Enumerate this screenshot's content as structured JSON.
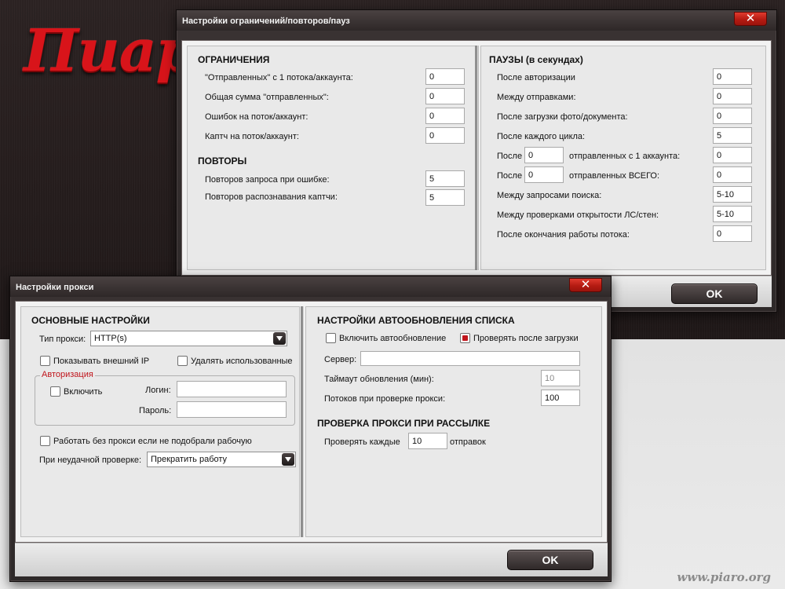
{
  "logo_text": "Пиар",
  "watermark": "www.piaro.org",
  "limits_window": {
    "title": "Настройки ограничений/повторов/пауз",
    "close_glyph": "✕",
    "ok_label": "OK",
    "limits": {
      "heading": "ОГРАНИЧЕНИЯ",
      "rows": [
        {
          "label": "\"Отправленных\" с 1 потока/аккаунта:",
          "value": "0"
        },
        {
          "label": "Общая сумма \"отправленных\":",
          "value": "0"
        },
        {
          "label": "Ошибок на поток/аккаунт:",
          "value": "0"
        },
        {
          "label": "Каптч на поток/аккаунт:",
          "value": "0"
        }
      ]
    },
    "retries": {
      "heading": "ПОВТОРЫ",
      "rows": [
        {
          "label": "Повторов запроса при ошибке:",
          "value": "5"
        },
        {
          "label": "Повторов распознавания каптчи:",
          "value": "5"
        }
      ]
    },
    "pauses": {
      "heading": "ПАУЗЫ (в секундах)",
      "after_auth": {
        "label": "После авторизации",
        "value": "0"
      },
      "between_sends": {
        "label": "Между отправками:",
        "value": "0"
      },
      "after_upload": {
        "label": "После загрузки фото/документа:",
        "value": "0"
      },
      "after_cycle": {
        "label": "После каждого цикла:",
        "value": "5"
      },
      "after_sent_account": {
        "prefix": "После",
        "count": "0",
        "label": "отправленных с 1 аккаунта:",
        "value": "0"
      },
      "after_sent_total": {
        "prefix": "После",
        "count": "0",
        "label": "отправленных ВСЕГО:",
        "value": "0"
      },
      "between_search": {
        "label": "Между запросами поиска:",
        "value": "5-10"
      },
      "between_checks": {
        "label": "Между проверками открытости ЛС/стен:",
        "value": "5-10"
      },
      "after_thread_end": {
        "label": "После окончания работы потока:",
        "value": "0"
      }
    }
  },
  "proxy_window": {
    "title": "Настройки прокси",
    "close_glyph": "✕",
    "ok_label": "OK",
    "main": {
      "heading": "ОСНОВНЫЕ НАСТРОЙКИ",
      "proxy_type_label": "Тип прокси:",
      "proxy_type_value": "HTTP(s)",
      "show_ip_label": "Показывать внешний IP",
      "show_ip_checked": false,
      "delete_used_label": "Удалять использованные",
      "delete_used_checked": false,
      "auth": {
        "title": "Авторизация",
        "enable_label": "Включить",
        "enable_checked": false,
        "login_label": "Логин:",
        "login_value": "",
        "password_label": "Пароль:",
        "password_value": ""
      },
      "no_proxy_label": "Работать без прокси если не подобрали рабочую",
      "no_proxy_checked": false,
      "on_fail_label": "При неудачной проверке:",
      "on_fail_value": "Прекратить работу"
    },
    "autoupdate": {
      "heading": "НАСТРОЙКИ АВТООБНОВЛЕНИЯ СПИСКА",
      "enable_label": "Включить автообновление",
      "enable_checked": false,
      "check_after_label": "Проверять после загрузки",
      "check_after_checked": true,
      "server_label": "Сервер:",
      "server_value": "",
      "timeout_label": "Таймаут обновления (мин):",
      "timeout_value": "10",
      "threads_label": "Потоков при проверке прокси:",
      "threads_value": "100"
    },
    "mail_check": {
      "heading": "ПРОВЕРКА ПРОКСИ ПРИ РАССЫЛКЕ",
      "prefix": "Проверять каждые",
      "value": "10",
      "suffix": "отправок"
    }
  },
  "colors": {
    "accent_red": "#c0141b",
    "dark_chrome": "#2e2929",
    "panel_bg": "#e9e9e9"
  }
}
